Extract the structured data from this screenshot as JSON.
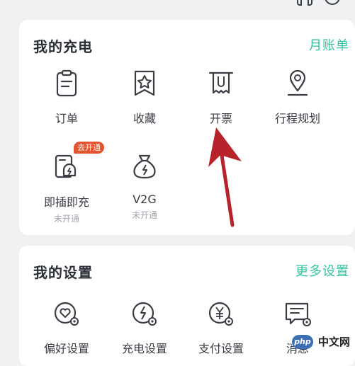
{
  "charging": {
    "title": "我的充电",
    "link": "月账单",
    "items": [
      {
        "label": "订单",
        "icon": "clipboard-icon"
      },
      {
        "label": "收藏",
        "icon": "star-bookmark-icon"
      },
      {
        "label": "开票",
        "icon": "receipt-icon"
      },
      {
        "label": "行程规划",
        "icon": "location-pin-icon"
      },
      {
        "label": "即插即充",
        "sub": "未开通",
        "badge": "去开通",
        "icon": "plug-charge-icon"
      },
      {
        "label": "V2G",
        "sub": "未开通",
        "icon": "money-bag-icon"
      }
    ]
  },
  "settings": {
    "title": "我的设置",
    "link": "更多设置",
    "items": [
      {
        "label": "偏好设置",
        "icon": "heart-gear-icon"
      },
      {
        "label": "充电设置",
        "icon": "bolt-gear-icon"
      },
      {
        "label": "支付设置",
        "icon": "yen-gear-icon"
      },
      {
        "label": "消息",
        "icon": "message-gear-icon"
      }
    ]
  },
  "watermark": {
    "logo": "php",
    "text": "中文网"
  },
  "colors": {
    "accent": "#34c3a2",
    "badge": "#e2532f",
    "arrow": "#b8222b",
    "icon_stroke": "#3a3d44"
  }
}
